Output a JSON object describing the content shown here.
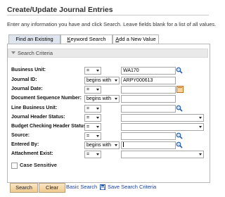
{
  "page": {
    "title": "Create/Update Journal Entries",
    "description": "Enter any information you have and click Search. Leave fields blank for a list of all values."
  },
  "tabs": [
    {
      "label": "Find an Existing Value",
      "active": true
    },
    {
      "label_underlined": "K",
      "label_rest": "eyword Search",
      "active": false
    },
    {
      "label_underlined": "A",
      "label_rest": "dd a New Value",
      "active": false
    }
  ],
  "criteria": {
    "header": "Search Criteria",
    "fields": [
      {
        "label": "Business Unit:",
        "operator": "=",
        "value": "WA170",
        "lookup": "search-icon"
      },
      {
        "label": "Journal ID:",
        "operator": "begins with",
        "value": "ARPY000613"
      },
      {
        "label": "Journal Date:",
        "operator": "=",
        "value": "",
        "lookup": "calendar-icon"
      },
      {
        "label": "Document Sequence Number:",
        "operator": "begins with",
        "value": ""
      },
      {
        "label": "Line Business Unit:",
        "operator": "=",
        "value": "",
        "lookup": "search-icon"
      },
      {
        "label": "Journal Header Status:",
        "operator": "=",
        "value": ""
      },
      {
        "label": "Budget Checking Header Status:",
        "operator": "=",
        "value": ""
      },
      {
        "label": "Source:",
        "operator": "=",
        "value": "",
        "lookup": "search-icon"
      },
      {
        "label": "Entered By:",
        "operator": "begins with",
        "value": "",
        "lookup": "search-icon"
      },
      {
        "label": "Attachment Exist:",
        "operator": "=",
        "value": ""
      }
    ],
    "case_sensitive_label": "Case Sensitive",
    "case_sensitive_checked": false
  },
  "actions": {
    "search_label": "Search",
    "clear_label": "Clear",
    "basic_search_label": "Basic Search",
    "save_criteria_label": "Save Search Criteria"
  },
  "colors": {
    "tab_active": "#dfe5ee",
    "button_gradient_top": "#fbe6c6",
    "button_gradient_bottom": "#efc98e",
    "link": "#1a40a0",
    "header_arrow": "#888888"
  }
}
